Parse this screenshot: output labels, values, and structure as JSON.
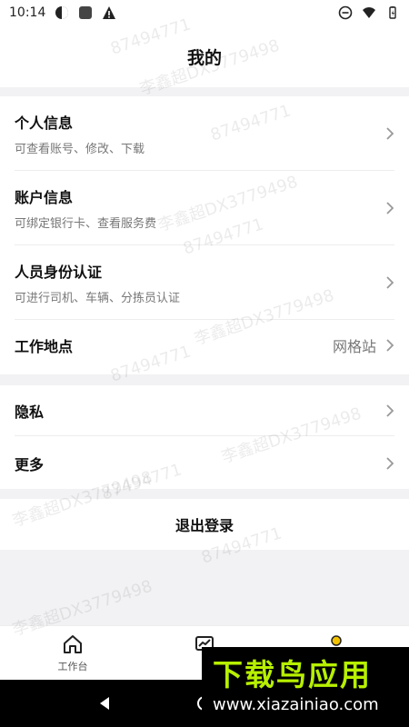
{
  "status": {
    "time": "10:14"
  },
  "header": {
    "title": "我的"
  },
  "group1": {
    "items": [
      {
        "title": "个人信息",
        "subtitle": "可查看账号、修改、下载"
      },
      {
        "title": "账户信息",
        "subtitle": "可绑定银行卡、查看服务费"
      },
      {
        "title": "人员身份认证",
        "subtitle": "可进行司机、车辆、分拣员认证"
      },
      {
        "title": "工作地点",
        "value": "网格站"
      }
    ]
  },
  "group2": {
    "items": [
      {
        "title": "隐私"
      },
      {
        "title": "更多"
      }
    ]
  },
  "logout": {
    "label": "退出登录"
  },
  "bottom_nav": {
    "items": [
      {
        "label": "工作台",
        "icon": "home-icon"
      },
      {
        "label": "",
        "icon": "chart-icon"
      },
      {
        "label": "",
        "icon": "user-icon"
      }
    ]
  },
  "watermarks": [
    "87494771",
    "李鑫超DX3779498",
    "87494771",
    "李鑫超DX3779498",
    "87494771",
    "李鑫超DX3779498",
    "87494771",
    "李鑫超DX3779498",
    "87494771",
    "李鑫超DX3779498",
    "87494771",
    "李鑫超DX3779498"
  ],
  "ad": {
    "brand": "下载鸟应用",
    "url": "www.xiazainiao.com"
  },
  "colors": {
    "background": "#f2f2f4",
    "card": "#ffffff",
    "text_primary": "#111111",
    "text_secondary": "#777777",
    "ad_accent": "#b7f000",
    "nav_active": "#f2c200"
  }
}
